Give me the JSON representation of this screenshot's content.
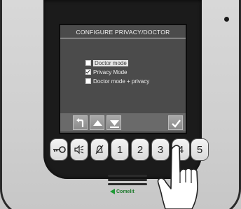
{
  "screen": {
    "title": "CONFIGURE PRIVACY/DOCTOR",
    "options": [
      {
        "label": "Doctor mode",
        "checked": false,
        "selected": true
      },
      {
        "label": "Privacy Mode",
        "checked": true,
        "selected": false
      },
      {
        "label": "Doctor mode + privacy",
        "checked": false,
        "selected": false
      }
    ],
    "softkeys": [
      "back-arrow-icon",
      "up-arrow-icon",
      "down-arrow-icon",
      "confirm-check-icon"
    ]
  },
  "keypad": {
    "icon_keys": [
      "key-icon",
      "speaker-icon",
      "bell-mute-icon"
    ],
    "number_keys": [
      "1",
      "2",
      "3",
      "4",
      "5"
    ]
  },
  "brand": {
    "name": "Comelit",
    "color": "#1f9a36"
  },
  "colors": {
    "screen_bg": "#4b4b4b",
    "bezel": "#1b1b1b",
    "housing": "#d3d3d3"
  }
}
